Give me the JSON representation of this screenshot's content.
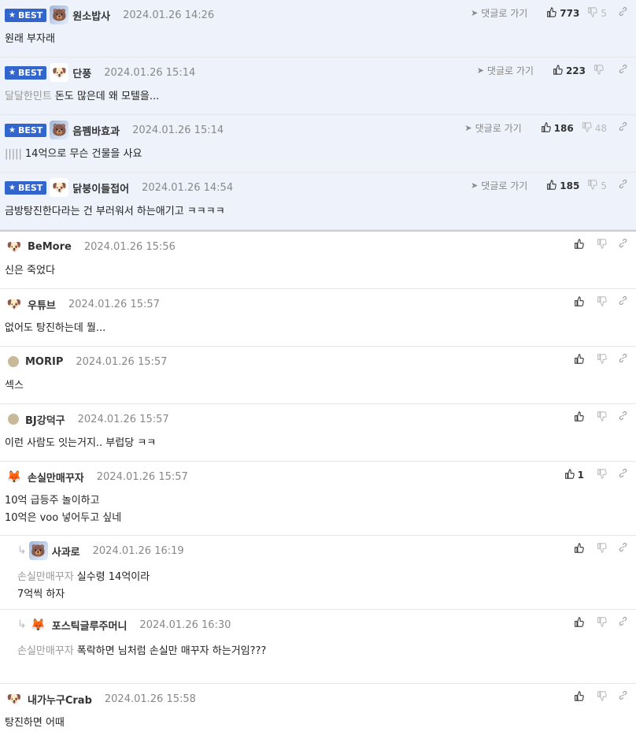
{
  "ui": {
    "badge": "BEST",
    "goto_label": "댓글로 가기"
  },
  "best_comments": [
    {
      "nick": "원소밥사",
      "date": "2024.01.26 14:26",
      "text": "원래 부자래",
      "mention": "",
      "likes": "773",
      "dislikes": "5",
      "avatar": "img1"
    },
    {
      "nick": "단풍",
      "date": "2024.01.26 15:14",
      "text": "돈도 많은데 왜 모텔을...",
      "mention": "달달한민트",
      "likes": "223",
      "dislikes": "",
      "avatar": "img2"
    },
    {
      "nick": "음펨바효과",
      "date": "2024.01.26 15:14",
      "text": "14억으로 무슨 건물을 사요",
      "mention": "|||||",
      "likes": "186",
      "dislikes": "48",
      "avatar": "img1"
    },
    {
      "nick": "닭붕이들접어",
      "date": "2024.01.26 14:54",
      "text": "금방탕진한다라는 건 부러워서 하는애기고 ㅋㅋㅋㅋ",
      "mention": "",
      "likes": "185",
      "dislikes": "5",
      "avatar": "dog"
    }
  ],
  "comments": [
    {
      "nick": "BeMore",
      "date": "2024.01.26 15:56",
      "lines": [
        "신은 죽었다"
      ],
      "mention": "",
      "likes": "",
      "avatar": "dog",
      "kind": "normal"
    },
    {
      "nick": "우튜브",
      "date": "2024.01.26 15:57",
      "lines": [
        "없어도 탕진하는데 뭘..."
      ],
      "mention": "",
      "likes": "",
      "avatar": "dog",
      "kind": "normal"
    },
    {
      "nick": "MORIP",
      "date": "2024.01.26 15:57",
      "lines": [
        "섹스"
      ],
      "mention": "",
      "likes": "",
      "avatar": "dot",
      "kind": "normal"
    },
    {
      "nick": "BJ강덕구",
      "date": "2024.01.26 15:57",
      "lines": [
        "이런 사람도 잇는거지.. 부럽당 ㅋㅋ"
      ],
      "mention": "",
      "likes": "",
      "avatar": "dot",
      "kind": "normal"
    },
    {
      "nick": "손실만매꾸자",
      "date": "2024.01.26 15:57",
      "lines": [
        "10억 급등주 놀이하고",
        "10억은 voo 넣어두고 싶네"
      ],
      "mention": "",
      "likes": "1",
      "avatar": "fox",
      "kind": "tall"
    },
    {
      "nick": "사과로",
      "date": "2024.01.26 16:19",
      "lines": [
        "실수령 14억이라",
        "7억씩 하자"
      ],
      "mention": "손실만매꾸자",
      "likes": "",
      "avatar": "img1",
      "kind": "reply"
    },
    {
      "nick": "포스틱글루주머니",
      "date": "2024.01.26 16:30",
      "lines": [
        "폭락하면 님처럼 손실만 매꾸자 하는거임???"
      ],
      "mention": "손실만매꾸자",
      "likes": "",
      "avatar": "fox",
      "kind": "reply"
    },
    {
      "nick": "내가누구Crab",
      "date": "2024.01.26 15:58",
      "lines": [
        "탕진하면 어때"
      ],
      "mention": "",
      "likes": "",
      "avatar": "dog",
      "kind": "last"
    }
  ],
  "icons": {
    "like": "thumbs-up-icon",
    "dislike": "thumbs-down-icon",
    "share": "link-icon",
    "goto": "arrow-icon"
  }
}
